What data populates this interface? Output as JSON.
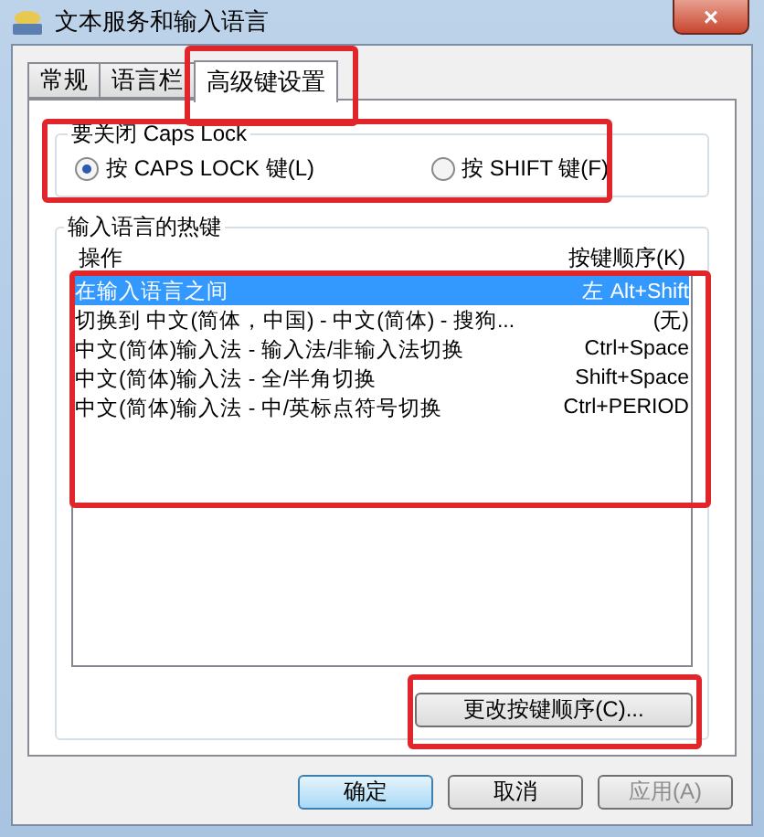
{
  "window": {
    "title": "文本服务和输入语言",
    "close": "×"
  },
  "tabs": [
    {
      "label": "常规",
      "selected": false,
      "highlighted": false
    },
    {
      "label": "语言栏",
      "selected": false,
      "highlighted": false
    },
    {
      "label": "高级键设置",
      "selected": true,
      "highlighted": true
    }
  ],
  "caps_lock": {
    "title": "要关闭 Caps Lock",
    "highlighted": true,
    "options": [
      {
        "label": "按 CAPS LOCK 键(L)",
        "selected": true
      },
      {
        "label": "按 SHIFT 键(F)",
        "selected": false
      }
    ]
  },
  "hotkeys": {
    "title": "输入语言的热键",
    "columns": [
      "操作",
      "按键顺序(K)"
    ],
    "highlighted": true,
    "rows": [
      {
        "action": "在输入语言之间",
        "keys": "左 Alt+Shift",
        "selected": true
      },
      {
        "action": "切换到 中文(简体，中国) - 中文(简体) - 搜狗...",
        "keys": "(无)",
        "selected": false
      },
      {
        "action": "中文(简体)输入法 - 输入法/非输入法切换",
        "keys": "Ctrl+Space",
        "selected": false
      },
      {
        "action": "中文(简体)输入法 - 全/半角切换",
        "keys": "Shift+Space",
        "selected": false
      },
      {
        "action": "中文(简体)输入法 - 中/英标点符号切换",
        "keys": "Ctrl+PERIOD",
        "selected": false
      }
    ]
  },
  "change_button": {
    "label": "更改按键顺序(C)...",
    "highlighted": true
  },
  "buttons": [
    {
      "label": "确定",
      "kind": "default",
      "disabled": false
    },
    {
      "label": "取消",
      "kind": "normal",
      "disabled": false
    },
    {
      "label": "应用(A)",
      "kind": "normal",
      "disabled": true
    }
  ]
}
